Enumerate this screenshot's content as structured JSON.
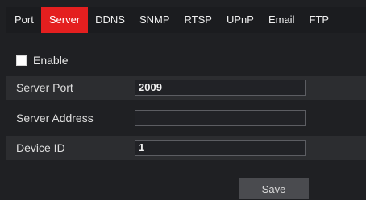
{
  "tabs": [
    {
      "label": "Port",
      "active": false
    },
    {
      "label": "Server",
      "active": true
    },
    {
      "label": "DDNS",
      "active": false
    },
    {
      "label": "SNMP",
      "active": false
    },
    {
      "label": "RTSP",
      "active": false
    },
    {
      "label": "UPnP",
      "active": false
    },
    {
      "label": "Email",
      "active": false
    },
    {
      "label": "FTP",
      "active": false
    }
  ],
  "enable": {
    "label": "Enable",
    "checked": false
  },
  "fields": {
    "server_port": {
      "label": "Server Port",
      "value": "2009"
    },
    "server_address": {
      "label": "Server Address",
      "value": ""
    },
    "device_id": {
      "label": "Device ID",
      "value": "1"
    }
  },
  "save_label": "Save",
  "colors": {
    "accent": "#e41f1f",
    "background": "#1f2023",
    "row_shade": "#2c2d30"
  }
}
